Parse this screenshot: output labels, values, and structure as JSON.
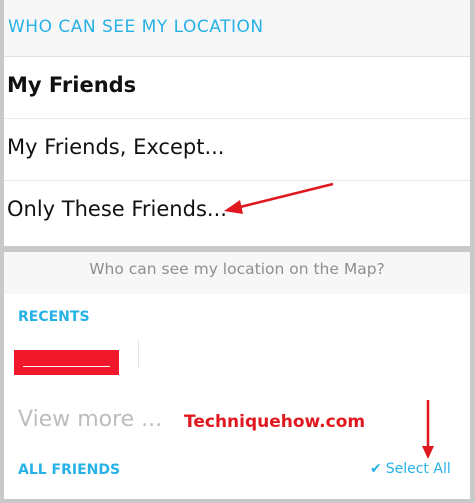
{
  "location_settings": {
    "header": "WHO CAN SEE MY LOCATION",
    "options": [
      {
        "label": "My Friends",
        "selected": true
      },
      {
        "label": "My Friends, Except..."
      },
      {
        "label": "Only These Friends..."
      }
    ]
  },
  "map_picker": {
    "question": "Who can see my location on the Map?",
    "recents_heading": "RECENTS",
    "view_more": "View more ...",
    "all_friends_heading": "ALL FRIENDS",
    "select_all": "Select All"
  },
  "watermark": "Techniquehow.com",
  "colors": {
    "accent": "#27b2e7",
    "annotation": "#e0171e",
    "redaction": "#f0182a",
    "muted_text": "#8f8f8f"
  },
  "icons": {
    "select_all_icon": "checkmark-icon",
    "annotations": [
      "arrow-left-icon",
      "arrow-down-icon"
    ]
  }
}
